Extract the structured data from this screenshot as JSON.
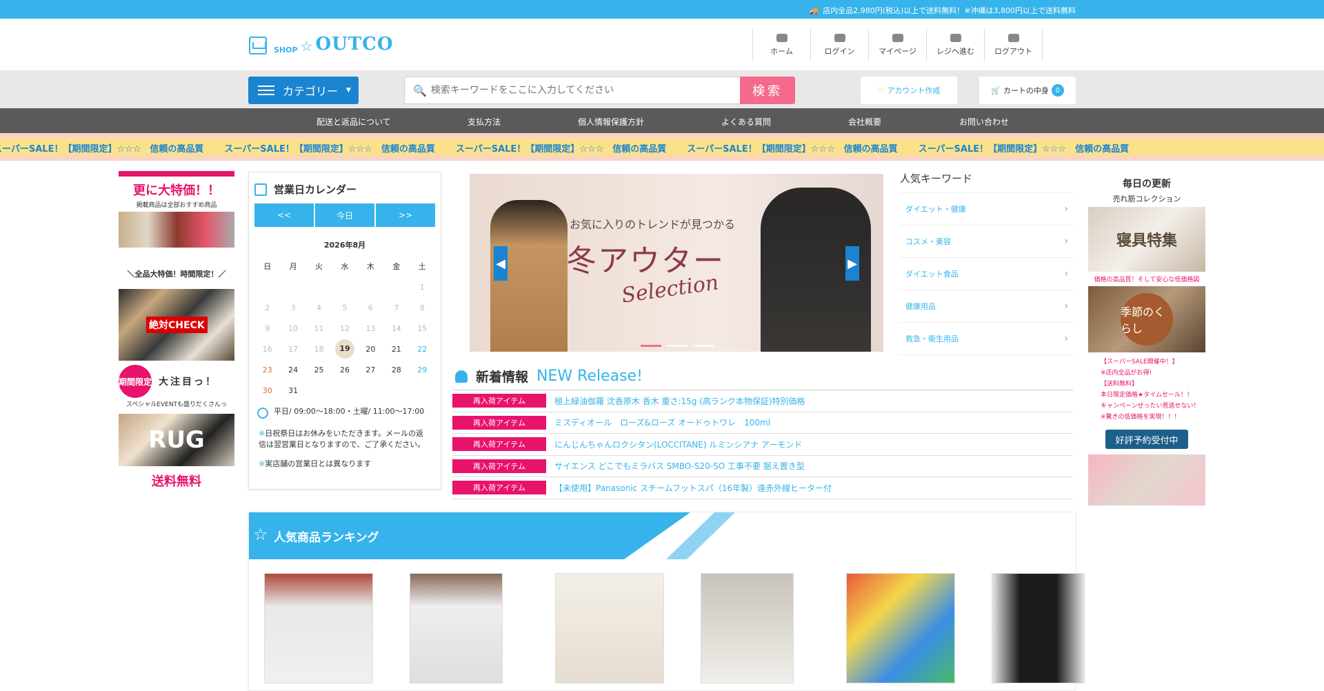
{
  "topbar": {
    "notice": "店内全品2,980円(税込)以上で送料無料！※沖縄は3,800円以上で送料無料"
  },
  "logo": {
    "shop": "SHOP",
    "name": "OUTCO"
  },
  "header_nav": [
    {
      "label": "ホーム",
      "icon": "home-icon"
    },
    {
      "label": "ログイン",
      "icon": "user-icon"
    },
    {
      "label": "マイページ",
      "icon": "id-card-icon"
    },
    {
      "label": "レジへ進む",
      "icon": "register-icon"
    },
    {
      "label": "ログアウト",
      "icon": "logout-icon"
    }
  ],
  "search": {
    "category_label": "カテゴリー",
    "placeholder": "検索キーワードをここに入力してください",
    "button": "検索",
    "account": "アカウント作成",
    "cart": "カートの中身",
    "cart_count": "0"
  },
  "main_nav": [
    "配送と返品について",
    "支払方法",
    "個人情報保護方針",
    "よくある質問",
    "会社概要",
    "お問い合わせ"
  ],
  "banner_text": "スーパーSALE！【期間限定】☆☆☆　信頼の高品質",
  "left_ad": {
    "title": "更に大特価！！",
    "subtitle": "掲載商品は全部おすすめ商品",
    "sale": "＼全品大特価！時間限定！／",
    "check": "絶対CHECK",
    "limited": "期間限定",
    "attention": "大注目っ！",
    "event": "スペシャルEVENTも盛りだくさんっ",
    "rug": "RUG",
    "free": "送料無料"
  },
  "calendar": {
    "title": "営業日カレンダー",
    "prev": "<<",
    "today": "今日",
    "next": ">>",
    "month": "2026年8月",
    "weekdays": [
      "日",
      "月",
      "火",
      "水",
      "木",
      "金",
      "土"
    ],
    "weeks": [
      [
        "",
        "",
        "",
        "",
        "",
        "",
        "1"
      ],
      [
        "2",
        "3",
        "4",
        "5",
        "6",
        "7",
        "8"
      ],
      [
        "9",
        "10",
        "11",
        "12",
        "13",
        "14",
        "15"
      ],
      [
        "16",
        "17",
        "18",
        "19",
        "20",
        "21",
        "22"
      ],
      [
        "23",
        "24",
        "25",
        "26",
        "27",
        "28",
        "29"
      ],
      [
        "30",
        "31",
        "",
        "",
        "",
        "",
        ""
      ]
    ],
    "hours": "平日/ 09:00～18:00・土曜/ 11:00～17:00",
    "note1": "日祝祭日はお休みをいただきます。メールの返信は翌営業日となりますので、ご了承ください。",
    "note2": "実店舗の営業日とは異なります"
  },
  "slider": {
    "line1": "お気に入りのトレンドが見つかる",
    "line2": "冬アウター",
    "line3": "Selection"
  },
  "keywords": {
    "title": "人気キーワード",
    "items": [
      "ダイエット・健康",
      "コスメ・美容",
      "ダイエット食品",
      "健康用品",
      "救急・衛生用品"
    ]
  },
  "news": {
    "title": "新着情報",
    "title_en": "NEW Release!",
    "items": [
      {
        "tag": "再入荷アイテム",
        "text": "極上緑油伽羅 沈香原木 香木 重さ:15g (高ランク本物保証)特別価格"
      },
      {
        "tag": "再入荷アイテム",
        "text": "ミスディオール　ローズ&ローズ オードゥトワレ　100ml"
      },
      {
        "tag": "再入荷アイテム",
        "text": "にんじんちゃんロクシタン(LOCCITANE) ルミンシアナ アーモンド"
      },
      {
        "tag": "再入荷アイテム",
        "text": "サイエンス どこでもミラバス SMBO-S20-SO 工事不要 据え置き型"
      },
      {
        "tag": "再入荷アイテム",
        "text": "【未使用】Panasonic スチームフットスパ（16年製）遠赤外線ヒーター付"
      }
    ]
  },
  "right_ad": {
    "title": "毎日の更新",
    "subtitle": "売れ筋コレクション",
    "bedding": "寝具特集",
    "bedding_caption": "価格の高品質！そして安心な低価格図",
    "season": "季節のくらし",
    "lines": [
      "【スーパーSALE開催中！】",
      "※店内全品がお得!",
      "【送料無料】",
      "本日限定価格★タイムセール！！",
      "キャンペーンぜったい見逃せない！",
      "※驚きの低価格を実現！！！"
    ],
    "preorder": "好評予約受付中"
  },
  "ranking": {
    "title": "人気商品ランキング"
  }
}
